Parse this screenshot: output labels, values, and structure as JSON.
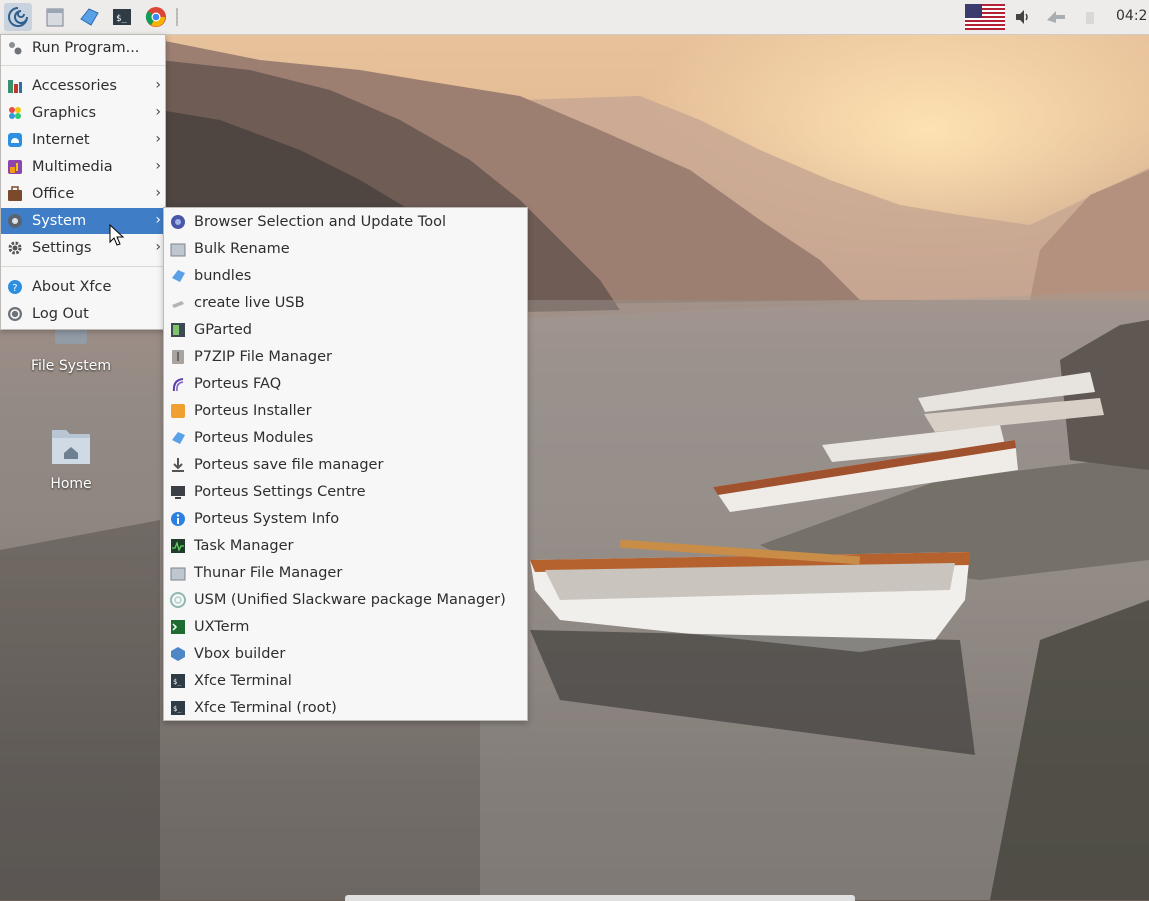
{
  "panel": {
    "launchers": [
      "porteus-menu-icon",
      "file-manager-icon",
      "porteus-modules-icon",
      "terminal-icon",
      "chrome-icon"
    ],
    "tray": [
      "us-flag-icon",
      "volume-icon",
      "network-icon",
      "battery-icon"
    ],
    "clock": "04:2"
  },
  "desktop": {
    "icons": [
      {
        "label": "File System",
        "icon": "drive-icon"
      },
      {
        "label": "Home",
        "icon": "home-folder-icon"
      }
    ]
  },
  "main_menu": {
    "run_program": "Run Program...",
    "categories": [
      {
        "label": "Accessories",
        "icon": "accessories-icon"
      },
      {
        "label": "Graphics",
        "icon": "graphics-icon"
      },
      {
        "label": "Internet",
        "icon": "internet-icon"
      },
      {
        "label": "Multimedia",
        "icon": "multimedia-icon"
      },
      {
        "label": "Office",
        "icon": "office-icon"
      },
      {
        "label": "System",
        "icon": "system-icon",
        "selected": true
      },
      {
        "label": "Settings",
        "icon": "settings-gear-icon"
      }
    ],
    "about": "About Xfce",
    "logout": "Log Out"
  },
  "system_submenu": {
    "items": [
      {
        "label": "Browser Selection and Update Tool",
        "icon": "browser-selection-icon"
      },
      {
        "label": "Bulk Rename",
        "icon": "bulk-rename-icon"
      },
      {
        "label": "bundles",
        "icon": "bundles-icon"
      },
      {
        "label": "create live USB",
        "icon": "usb-icon"
      },
      {
        "label": "GParted",
        "icon": "gparted-icon"
      },
      {
        "label": "P7ZIP File Manager",
        "icon": "p7zip-icon"
      },
      {
        "label": "Porteus FAQ",
        "icon": "porteus-faq-icon"
      },
      {
        "label": "Porteus Installer",
        "icon": "porteus-installer-icon"
      },
      {
        "label": "Porteus Modules",
        "icon": "porteus-modules-icon"
      },
      {
        "label": "Porteus save file manager",
        "icon": "download-arrow-icon"
      },
      {
        "label": "Porteus Settings Centre",
        "icon": "monitor-icon"
      },
      {
        "label": "Porteus System Info",
        "icon": "info-icon"
      },
      {
        "label": "Task Manager",
        "icon": "task-manager-icon"
      },
      {
        "label": "Thunar File Manager",
        "icon": "thunar-icon"
      },
      {
        "label": "USM (Unified Slackware package Manager)",
        "icon": "usm-icon"
      },
      {
        "label": "UXTerm",
        "icon": "uxterm-icon"
      },
      {
        "label": "Vbox builder",
        "icon": "vbox-icon"
      },
      {
        "label": "Xfce Terminal",
        "icon": "xfce-terminal-icon"
      },
      {
        "label": "Xfce Terminal (root)",
        "icon": "xfce-terminal-root-icon"
      }
    ]
  },
  "colors": {
    "selection": "#3f7ec7",
    "menu_bg": "#f7f7f7",
    "panel_bg": "#eeecea"
  }
}
